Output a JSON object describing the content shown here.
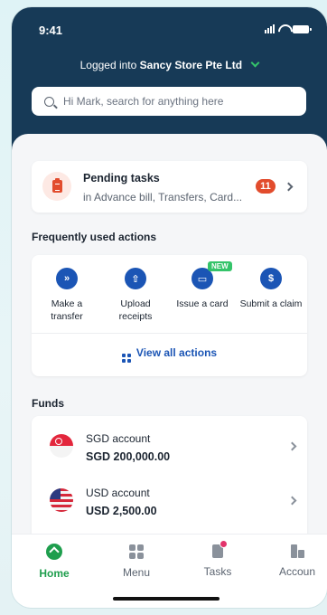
{
  "status_bar": {
    "time": "9:41"
  },
  "header": {
    "logged_prefix": "Logged into",
    "store_name": "Sancy Store Pte Ltd",
    "search_placeholder": "Hi Mark, search for anything here"
  },
  "pending": {
    "title": "Pending tasks",
    "subtitle": "in Advance bill, Transfers, Card...",
    "count": "11"
  },
  "actions": {
    "section_title": "Frequently used actions",
    "items": [
      {
        "label": "Make a transfer",
        "icon": "transfer-icon"
      },
      {
        "label": "Upload receipts",
        "icon": "upload-icon"
      },
      {
        "label": "Issue a card",
        "icon": "card-icon",
        "badge": "NEW"
      },
      {
        "label": "Submit a claim",
        "icon": "claim-icon"
      }
    ],
    "view_all": "View all actions"
  },
  "funds": {
    "section_title": "Funds",
    "accounts": [
      {
        "name": "SGD account",
        "amount": "SGD 200,000.00",
        "flag": "singapore-flag"
      },
      {
        "name": "USD account",
        "amount": "USD 2,500.00",
        "flag": "usa-flag"
      }
    ]
  },
  "nav": {
    "items": [
      {
        "label": "Home",
        "active": true
      },
      {
        "label": "Menu"
      },
      {
        "label": "Tasks"
      },
      {
        "label": "Accoun"
      }
    ]
  },
  "colors": {
    "header_bg": "#173a57",
    "accent_blue": "#1b55b5",
    "accent_green": "#1e9e4d",
    "badge_red": "#e24c2d"
  }
}
